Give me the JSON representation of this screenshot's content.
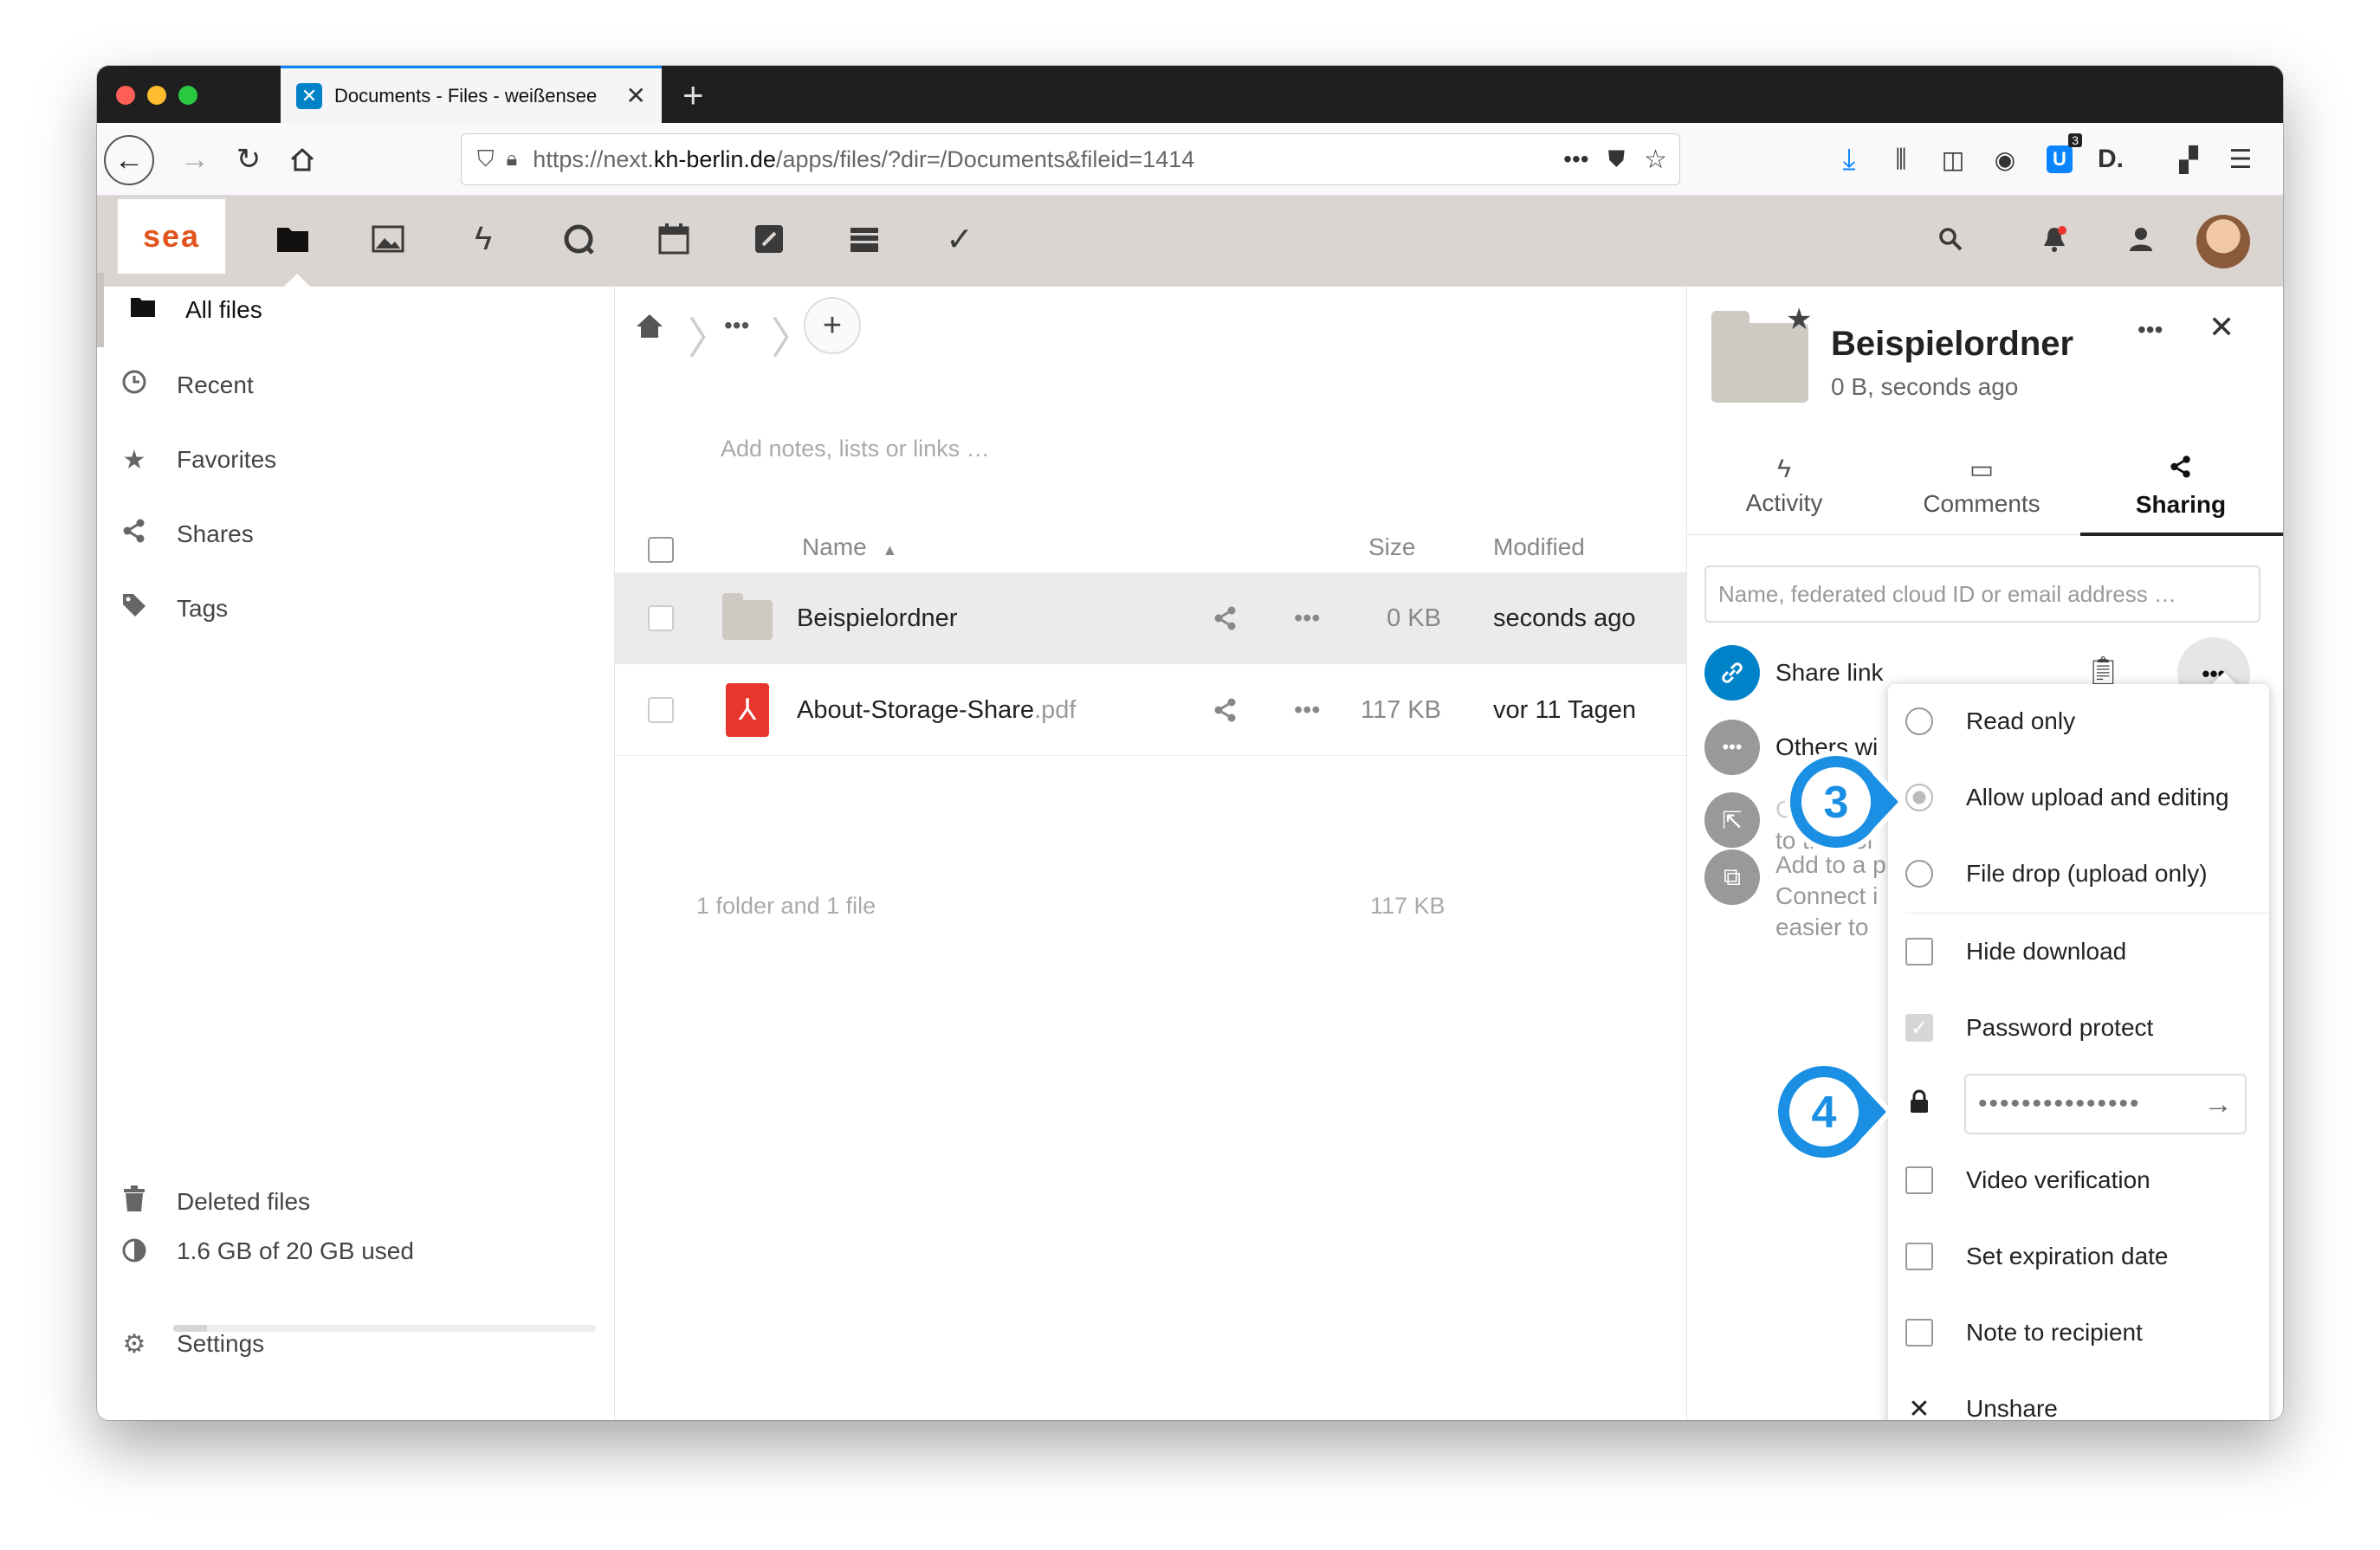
{
  "browser": {
    "tab_title": "Documents - Files - weißensee",
    "url_prefix": "https://next.",
    "url_domain": "kh-berlin.de",
    "url_path": "/apps/files/?dir=/Documents&fileid=1414",
    "badge_count": "3"
  },
  "header": {
    "logo_text": "sea"
  },
  "sidebar": {
    "items": [
      {
        "label": "All files"
      },
      {
        "label": "Recent"
      },
      {
        "label": "Favorites"
      },
      {
        "label": "Shares"
      },
      {
        "label": "Tags"
      }
    ],
    "deleted": "Deleted files",
    "quota": "1.6 GB of 20 GB used",
    "quota_fraction": 0.08,
    "settings": "Settings"
  },
  "files": {
    "notes_placeholder": "Add notes, lists or links …",
    "col_name": "Name",
    "col_size": "Size",
    "col_modified": "Modified",
    "rows": [
      {
        "name": "Beispielordner",
        "ext": "",
        "size": "0 KB",
        "modified": "seconds ago"
      },
      {
        "name": "About-Storage-Share",
        "ext": ".pdf",
        "size": "117 KB",
        "modified": "vor 11 Tagen"
      }
    ],
    "summary": "1 folder and 1 file",
    "summary_size": "117 KB"
  },
  "details": {
    "title": "Beispielordner",
    "subtitle": "0 B, seconds ago",
    "tabs": [
      {
        "label": "Activity"
      },
      {
        "label": "Comments"
      },
      {
        "label": "Sharing"
      }
    ],
    "share_placeholder": "Name, federated cloud ID or email address …",
    "share_link": "Share link",
    "others": "Others wi",
    "row3_line1": "G",
    "row3_line2": "to this fol",
    "row4_line1": "Add to a p",
    "row4_line2": "Connect i",
    "row4_line3": "easier to"
  },
  "menu": {
    "read_only": "Read only",
    "allow_upload": "Allow upload and editing",
    "file_drop": "File drop (upload only)",
    "hide_download": "Hide download",
    "password_protect": "Password protect",
    "password_value": "•••••••••••••••",
    "video_verification": "Video verification",
    "expiration": "Set expiration date",
    "note": "Note to recipient",
    "unshare": "Unshare"
  },
  "callouts": {
    "step3": "3",
    "step4": "4"
  },
  "colors": {
    "accent": "#0082c9",
    "callout": "#1a8fe3",
    "header_bg": "#dad5d0",
    "logo": "#e2551f"
  }
}
